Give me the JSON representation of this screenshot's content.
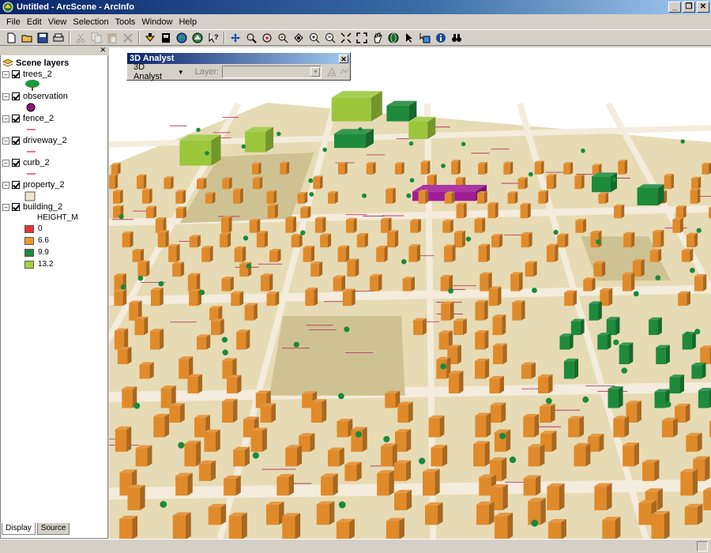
{
  "window": {
    "title": "Untitled - ArcScene - ArcInfo"
  },
  "menu": [
    "File",
    "Edit",
    "View",
    "Selection",
    "Tools",
    "Window",
    "Help"
  ],
  "toolbar_icons": [
    "new-icon",
    "open-icon",
    "save-icon",
    "print-icon",
    "cut-icon",
    "copy-icon",
    "paste-icon",
    "delete-icon",
    "add-data-icon",
    "scene-properties-icon",
    "globe-icon",
    "arcmap-icon",
    "whats-this-icon",
    "navigate-icon",
    "fly-icon",
    "target-center-icon",
    "zoom-to-target-icon",
    "set-observer-icon",
    "zoom-in-icon",
    "zoom-out-icon",
    "full-extent-icon",
    "extent-icon",
    "pan-icon",
    "globe-view-icon",
    "select-graphics-icon",
    "select-features-icon",
    "identify-icon",
    "find-icon"
  ],
  "toc": {
    "header": "Scene layers",
    "layers": [
      {
        "name": "trees_2",
        "symbol": "tree"
      },
      {
        "name": "observation",
        "symbol": "point"
      },
      {
        "name": "fence_2",
        "symbol": "line"
      },
      {
        "name": "driveway_2",
        "symbol": "line"
      },
      {
        "name": "curb_2",
        "symbol": "line"
      },
      {
        "name": "property_2",
        "symbol": "polygon"
      },
      {
        "name": "building_2",
        "symbol": "classes"
      }
    ],
    "legend": {
      "field": "HEIGHT_M",
      "classes": [
        {
          "label": "0",
          "color": "#e63232"
        },
        {
          "label": "6.6",
          "color": "#f09a28"
        },
        {
          "label": "9.9",
          "color": "#1e8a3c"
        },
        {
          "label": "13.2",
          "color": "#a6d040"
        }
      ]
    },
    "tabs": [
      "Display",
      "Source"
    ]
  },
  "analyst": {
    "title": "3D Analyst",
    "menu_label": "3D Analyst",
    "layer_label": "Layer:",
    "layer_value": ""
  },
  "colors": {
    "ground": "#e6dbb4",
    "block": "#cfc292",
    "street": "#f4ecdc",
    "parcel_line": "#b0245a",
    "building_low": "#e08a2a",
    "building_mid": "#1e8a3c",
    "building_high": "#9cc63c",
    "building_sel": "#a01c96",
    "tree": "#1a8a3a"
  }
}
